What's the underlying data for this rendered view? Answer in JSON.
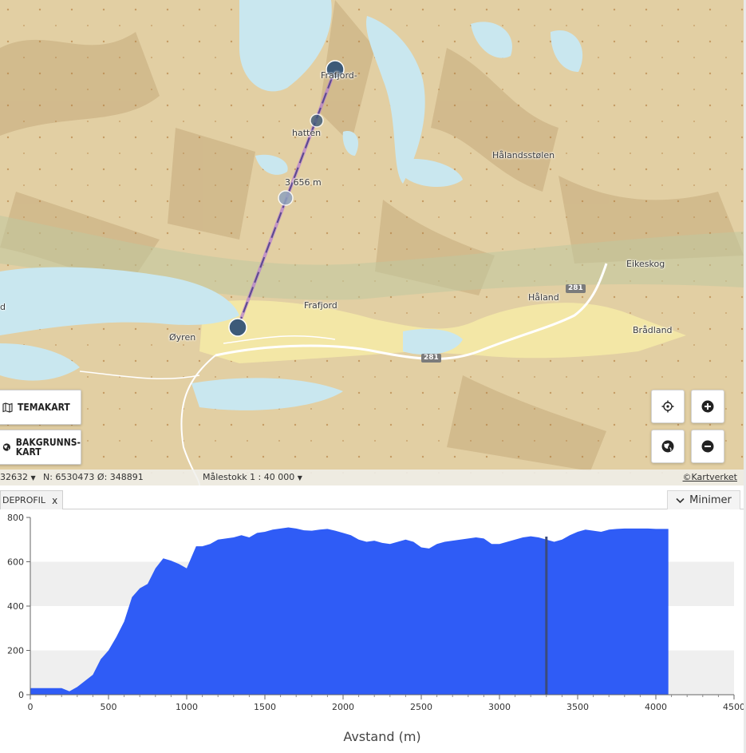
{
  "map": {
    "labels": {
      "frafjord_top": "Frafjord-",
      "hatten": "hatten",
      "distance_label": "3 656 m",
      "halandsstolen": "Hålandsstølen",
      "eikeskog": "Eikeskog",
      "haland": "Håland",
      "bradland": "Brådland",
      "frafjord": "Frafjord",
      "oyren": "Øyren",
      "edge_d": "d",
      "road_281_a": "281",
      "road_281_b": "281"
    },
    "buttons": {
      "temakart": "TEMAKART",
      "bakgrunnskart_line1": "BAKGRUNNS-",
      "bakgrunnskart_line2": "KART"
    },
    "icons": {
      "temakart": "map-icon",
      "bakgrunnskart": "globe-icon",
      "locate": "crosshair-icon",
      "zoom_in": "plus-icon",
      "world": "globe-icon",
      "zoom_out": "minus-icon"
    },
    "colors": {
      "water": "#c9e7ef",
      "terrain": "#e5d2a9",
      "lowland": "#f3e7a6",
      "profile_line": "#b57bd2",
      "marker": "#3d5a78"
    }
  },
  "statusbar": {
    "crs": "32632",
    "coords": "N: 6530473 Ø: 348891",
    "scale": "Målestokk 1 : 40 000",
    "attribution": "©Kartverket"
  },
  "panel": {
    "tab_label": "DEPROFIL",
    "tab_close": "x",
    "minimize_label": "Minimer"
  },
  "chart_data": {
    "type": "area",
    "xlabel": "Avstand (m)",
    "ylabel": "",
    "xlim": [
      0,
      4500
    ],
    "ylim": [
      0,
      800
    ],
    "xticks": [
      0,
      500,
      1000,
      1500,
      2000,
      2500,
      3000,
      3500,
      4000,
      4500
    ],
    "yticks": [
      0,
      200,
      400,
      600,
      800
    ],
    "fill_color": "#2f5cf6",
    "cursor_x": 3300,
    "x": [
      0,
      200,
      250,
      300,
      400,
      450,
      500,
      550,
      600,
      650,
      700,
      750,
      800,
      850,
      900,
      950,
      1000,
      1030,
      1060,
      1100,
      1150,
      1200,
      1250,
      1300,
      1350,
      1400,
      1450,
      1500,
      1550,
      1600,
      1650,
      1700,
      1750,
      1800,
      1850,
      1900,
      1950,
      2000,
      2050,
      2100,
      2150,
      2200,
      2250,
      2300,
      2350,
      2400,
      2450,
      2500,
      2550,
      2600,
      2650,
      2700,
      2750,
      2800,
      2850,
      2900,
      2950,
      3000,
      3050,
      3100,
      3150,
      3200,
      3250,
      3300,
      3350,
      3400,
      3450,
      3500,
      3550,
      3600,
      3650,
      3700,
      3750,
      3800,
      3850,
      3900,
      3950,
      4000,
      4080
    ],
    "y": [
      30,
      30,
      15,
      35,
      90,
      160,
      200,
      260,
      330,
      440,
      480,
      500,
      570,
      615,
      605,
      590,
      570,
      620,
      670,
      670,
      680,
      700,
      705,
      710,
      720,
      710,
      730,
      735,
      745,
      750,
      755,
      750,
      742,
      740,
      745,
      748,
      740,
      730,
      720,
      700,
      690,
      695,
      685,
      680,
      690,
      700,
      690,
      665,
      660,
      680,
      690,
      695,
      700,
      705,
      710,
      705,
      680,
      680,
      690,
      700,
      710,
      715,
      710,
      700,
      690,
      700,
      720,
      735,
      745,
      740,
      735,
      745,
      748,
      750,
      750,
      750,
      750,
      748,
      748
    ]
  }
}
